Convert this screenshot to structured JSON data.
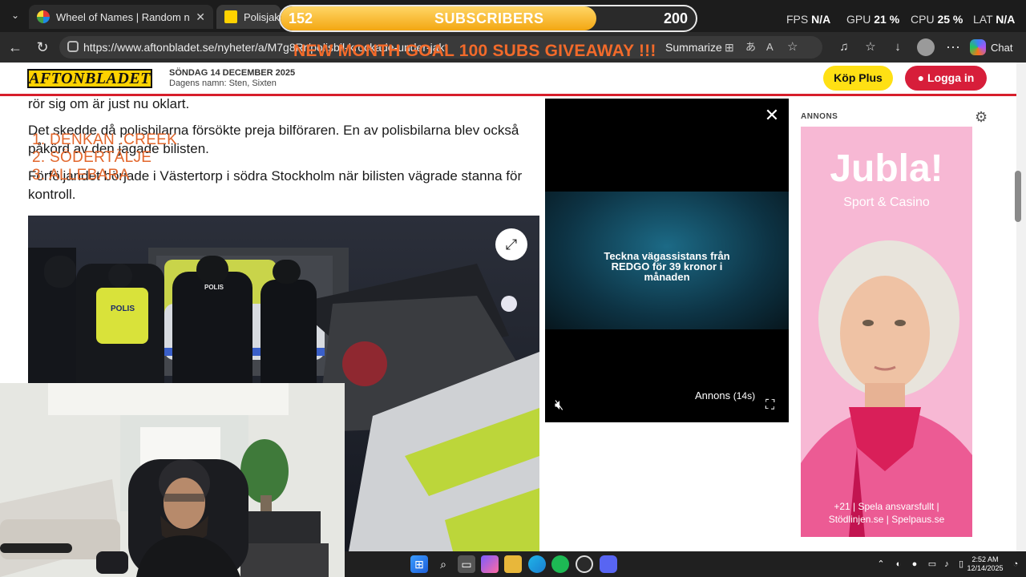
{
  "browser": {
    "tabs": [
      {
        "title": "Wheel of Names | Random name picker"
      },
      {
        "title": "Polisjakt i södra Stockholm"
      }
    ],
    "url": "https://www.aftonbladet.se/nyheter/a/M7g8Rr/polisbil-krockade-under-jakt",
    "summarize_label": "Summarize",
    "chat_label": "Chat"
  },
  "overlay": {
    "subs_current": "152",
    "subs_label": "SUBSCRIBERS",
    "subs_goal": "200",
    "subs_progress": 0.76,
    "goal_text": "NEW MONTH GOAL 100 SUBS GIVEAWAY !!!",
    "stats": [
      {
        "label": "FPS",
        "value": "N/A"
      },
      {
        "label": "GPU",
        "value": "21 %"
      },
      {
        "label": "CPU",
        "value": "25 %"
      },
      {
        "label": "LAT",
        "value": "N/A"
      }
    ],
    "ranking": [
      "1.  DENKAN .CREEK",
      "2.  SÖDERTÄLJE",
      "3.  ALLEBARA"
    ]
  },
  "site": {
    "logo": "AFTONBLADET",
    "date": "SÖNDAG 14 DECEMBER 2025",
    "names_day": "Dagens namn: Sten, Sixten",
    "kop_plus": "Köp Plus",
    "logga_in": "Logga in"
  },
  "article": {
    "para1": "rör sig om är just nu oklart.",
    "para2": "Det skedde då polisbilarna försökte preja bilföraren. En av polisbilarna blev också påkörd av den jagade bilisten.",
    "para3": "Förföljandet började i Västertorp i södra Stockholm när bilisten vägrade stanna för kontroll.",
    "photo_text": "POLIS"
  },
  "video_ad": {
    "text": "Teckna vägassistans från REDGO för 39 kronor i månaden",
    "annons": "Annons",
    "countdown": "(14s)"
  },
  "side_ad": {
    "label": "ANNONS",
    "brand": "Jubla!",
    "tagline": "Sport & Casino",
    "footer": "+21 | Spela ansvarsfullt | Stödlinjen.se | Spelpaus.se"
  },
  "taskbar": {
    "time": "2:52 AM",
    "date": "12/14/2025"
  }
}
